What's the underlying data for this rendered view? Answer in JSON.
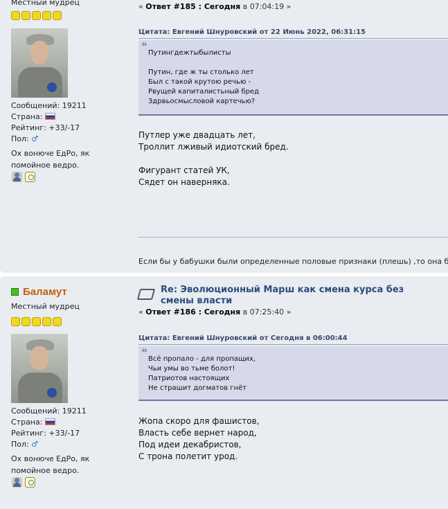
{
  "posts": [
    {
      "author": {
        "name": "",
        "rank": "Местный мудрец",
        "stars": 5,
        "messages": "Сообщений: 19211",
        "country": "Страна:",
        "rating": "Рейтинг: +33/-17",
        "gender": "Пол:",
        "gender_symbol": "♂",
        "signature_quote": [
          "Ох вонюче ЕдРо, як",
          "помойное ведро."
        ]
      },
      "meta": {
        "prefix": "« ",
        "reply": "Ответ #185 : Сегодня",
        "at": " в 07:04:19",
        "suffix": " »"
      },
      "quote_header": "Цитата: Евгений Шнуровский от 22 Июнь 2022, 06:31:15",
      "quote_lines": [
        "Путингдежтыбылисты",
        "",
        "Путин, где ж ты столько лет",
        "Был с такой крутою речью -",
        "Рвущей капиталистьный бред",
        "Здрвьосмысловой картечью?"
      ],
      "body_lines": [
        "Путлер уже двадцать лет,",
        "Троллит лживый идиотский бред.",
        "",
        "Фигурант статей УК,",
        "Сядет он наверняка."
      ],
      "signature": "Если бы у бабушки были определенные половые признаки (плешь) ,то она была"
    },
    {
      "author": {
        "name": "Баламут",
        "rank": "Местный мудрец",
        "stars": 5,
        "messages": "Сообщений: 19211",
        "country": "Страна:",
        "rating": "Рейтинг: +33/-17",
        "gender": "Пол:",
        "gender_symbol": "♂",
        "signature_quote": [
          "Ох вонюче ЕдРо, як",
          "помойное ведро."
        ]
      },
      "title": "Re: Эволюционный Марш как смена курса без смены власти",
      "meta": {
        "prefix": "« ",
        "reply": "Ответ #186 : Сегодня",
        "at": " в 07:25:40",
        "suffix": " »"
      },
      "quote_header": "Цитата: Евгений Шнуровский от Сегодня в 06:00:44",
      "quote_lines": [
        "Всё пропало - для пропащих,",
        "Чьи умы во тьме болот!",
        "Патриотов настоящих",
        "Не страшит догматов гнёт"
      ],
      "body_lines": [
        "Жопа скоро для фашистов,",
        "Власть себе вернет народ,",
        "Под идеи декабристов,",
        "С трона полетит урод."
      ]
    }
  ],
  "icons": [
    "online-status-icon",
    "star-icon",
    "russia-flag-icon",
    "male-icon",
    "profile-icon",
    "pm-icon",
    "topic-icon",
    "quote-mark-icon"
  ],
  "colors": {
    "username": "#c06010",
    "title": "#2b4c7e",
    "quote_bg": "#d6d9e9",
    "post_bg": "#e9ecf1"
  }
}
